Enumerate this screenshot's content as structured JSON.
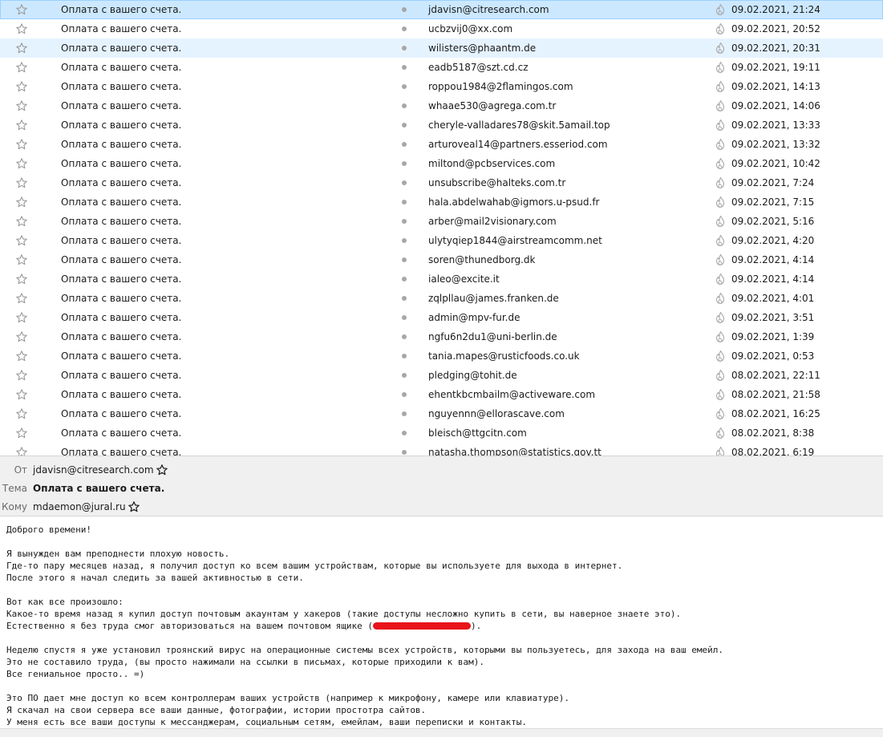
{
  "message_list": {
    "selected_index": 0,
    "hovered_index": 2,
    "rows": [
      {
        "subject": "Оплата с вашего счета.",
        "sender": "jdavisn@citresearch.com",
        "date": "09.02.2021, 21:24"
      },
      {
        "subject": "Оплата с вашего счета.",
        "sender": "ucbzvij0@xx.com",
        "date": "09.02.2021, 20:52"
      },
      {
        "subject": "Оплата с вашего счета.",
        "sender": "wilisters@phaantm.de",
        "date": "09.02.2021, 20:31"
      },
      {
        "subject": "Оплата с вашего счета.",
        "sender": "eadb5187@szt.cd.cz",
        "date": "09.02.2021, 19:11"
      },
      {
        "subject": "Оплата с вашего счета.",
        "sender": "roppou1984@2flamingos.com",
        "date": "09.02.2021, 14:13"
      },
      {
        "subject": "Оплата с вашего счета.",
        "sender": "whaae530@agrega.com.tr",
        "date": "09.02.2021, 14:06"
      },
      {
        "subject": "Оплата с вашего счета.",
        "sender": "cheryle-valladares78@skit.5amail.top",
        "date": "09.02.2021, 13:33"
      },
      {
        "subject": "Оплата с вашего счета.",
        "sender": "arturoveal14@partners.esseriod.com",
        "date": "09.02.2021, 13:32"
      },
      {
        "subject": "Оплата с вашего счета.",
        "sender": "miltond@pcbservices.com",
        "date": "09.02.2021, 10:42"
      },
      {
        "subject": "Оплата с вашего счета.",
        "sender": "unsubscribe@halteks.com.tr",
        "date": "09.02.2021, 7:24"
      },
      {
        "subject": "Оплата с вашего счета.",
        "sender": "hala.abdelwahab@igmors.u-psud.fr",
        "date": "09.02.2021, 7:15"
      },
      {
        "subject": "Оплата с вашего счета.",
        "sender": "arber@mail2visionary.com",
        "date": "09.02.2021, 5:16"
      },
      {
        "subject": "Оплата с вашего счета.",
        "sender": "ulytyqiep1844@airstreamcomm.net",
        "date": "09.02.2021, 4:20"
      },
      {
        "subject": "Оплата с вашего счета.",
        "sender": "soren@thunedborg.dk",
        "date": "09.02.2021, 4:14"
      },
      {
        "subject": "Оплата с вашего счета.",
        "sender": "ialeo@excite.it",
        "date": "09.02.2021, 4:14"
      },
      {
        "subject": "Оплата с вашего счета.",
        "sender": "zqlpllau@james.franken.de",
        "date": "09.02.2021, 4:01"
      },
      {
        "subject": "Оплата с вашего счета.",
        "sender": "admin@mpv-fur.de",
        "date": "09.02.2021, 3:51"
      },
      {
        "subject": "Оплата с вашего счета.",
        "sender": "ngfu6n2du1@uni-berlin.de",
        "date": "09.02.2021, 1:39"
      },
      {
        "subject": "Оплата с вашего счета.",
        "sender": "tania.mapes@rusticfoods.co.uk",
        "date": "09.02.2021, 0:53"
      },
      {
        "subject": "Оплата с вашего счета.",
        "sender": "pledging@tohit.de",
        "date": "08.02.2021, 22:11"
      },
      {
        "subject": "Оплата с вашего счета.",
        "sender": "ehentkbcmbailm@activeware.com",
        "date": "08.02.2021, 21:58"
      },
      {
        "subject": "Оплата с вашего счета.",
        "sender": "nguyennn@ellorascave.com",
        "date": "08.02.2021, 16:25"
      },
      {
        "subject": "Оплата с вашего счета.",
        "sender": "bleisch@ttgcitn.com",
        "date": "08.02.2021, 8:38"
      },
      {
        "subject": "Оплата с вашего счета.",
        "sender": "natasha.thompson@statistics.gov.tt",
        "date": "08.02.2021, 6:19"
      }
    ],
    "icons": {
      "star": "star-icon",
      "read_status": "read-dot-icon",
      "thread": "flame-icon"
    }
  },
  "header": {
    "from_label": "От",
    "from_value": "jdavisn@citresearch.com",
    "subject_label": "Тема",
    "subject_value": "Оплата с вашего счета.",
    "to_label": "Кому",
    "to_value": "mdaemon@jural.ru"
  },
  "body": {
    "lines": [
      "Доброго времени!",
      "",
      "Я вынужден вам преподнести плохую новость.",
      "Где-то пару месяцев назад, я получил доступ ко всем вашим устройствам, которые вы используете для выхода в интернет.",
      "После этого я начал следить за вашей активностью в сети.",
      "",
      "Вот как все произошло:",
      "Какое-то время назад я купил доступ почтовым акаунтам у хакеров (такие доступы несложно купить в сети, вы наверное знаете это).",
      "Естественно я без труда смог авторизоваться на вашем почтовом ящике (",
      "",
      "Неделю спустя я уже установил троянский вирус на операционные системы всех устройств, которыми вы пользуетесь, для захода на ваш емейл.",
      "Это не составило труда, (вы просто нажимали на ссылки в письмах, которые приходили к вам).",
      "Все гениальное просто.. =)",
      "",
      "Это ПО дает мне доступ ко всем контроллерам ваших устройств (например к микрофону, камере или клавиатуре).",
      "Я скачал на свои сервера все ваши данные, фотографии, истории простотра сайтов.",
      "У меня есть все ваши доступы к мессанджерам, социальным сетям, емейлам, ваши переписки и контакты."
    ],
    "redacted_line_index": 8,
    "redacted_suffix": ").",
    "redaction_color": "#e8131b"
  },
  "colors": {
    "selected_row": "#cce8ff",
    "hovered_row": "#e5f3ff",
    "header_bg": "#f0f0f0"
  }
}
